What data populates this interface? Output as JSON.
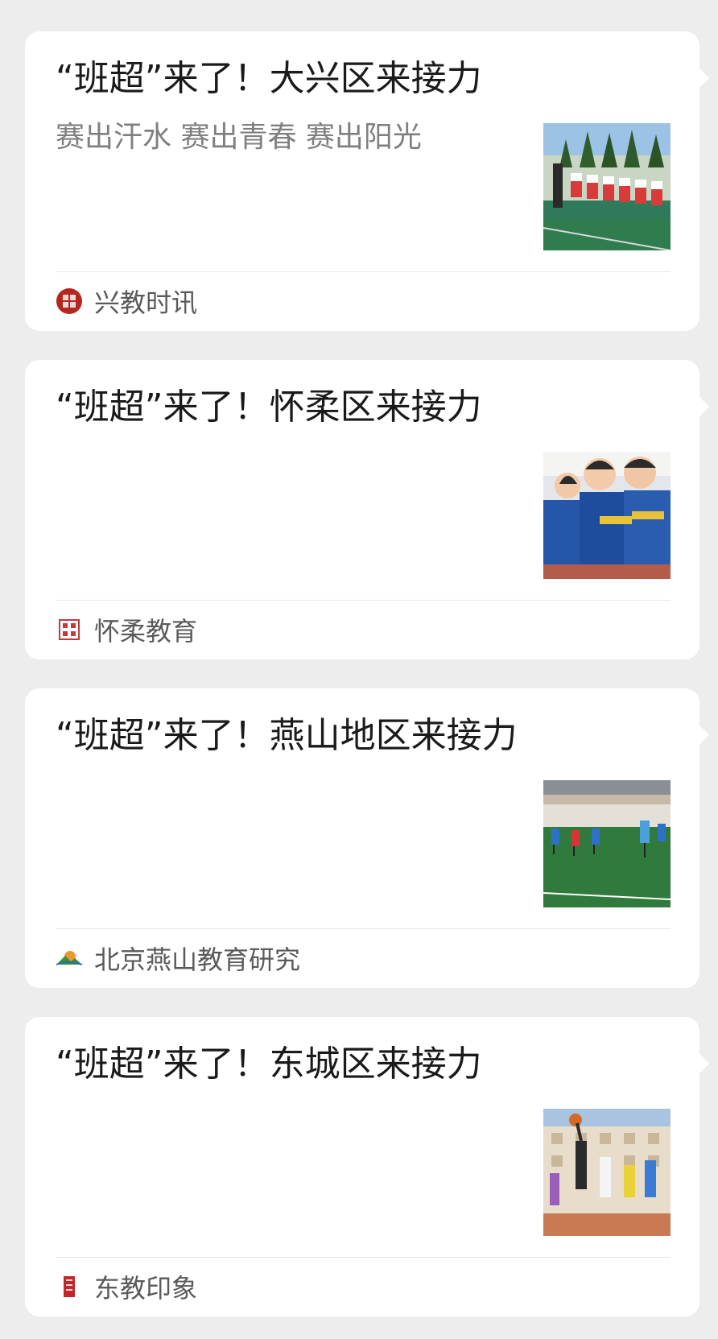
{
  "articles": [
    {
      "title": "“班超”来了！大兴区来接力",
      "subtitle": "赛出汗水 赛出青春 赛出阳光",
      "thumbnail": "tug-of-war-on-track-photo",
      "source": {
        "name": "兴教时讯",
        "icon": "red-seal-logo-icon"
      }
    },
    {
      "title": "“班超”来了！怀柔区来接力",
      "subtitle": "",
      "thumbnail": "kids-in-blue-uniforms-photo",
      "source": {
        "name": "怀柔教育",
        "icon": "square-seal-logo-icon"
      }
    },
    {
      "title": "“班超”来了！燕山地区来接力",
      "subtitle": "",
      "thumbnail": "kids-on-football-field-photo",
      "source": {
        "name": "北京燕山教育研究",
        "icon": "mountain-sun-logo-icon"
      }
    },
    {
      "title": "“班超”来了！东城区来接力",
      "subtitle": "",
      "thumbnail": "basketball-game-photo",
      "source": {
        "name": "东教印象",
        "icon": "red-tag-logo-icon"
      }
    }
  ],
  "colors": {
    "background": "#ededed",
    "card": "#ffffff",
    "title": "#1a1a1a",
    "subtitle": "#7f7f7f",
    "source": "#5a5a5a"
  }
}
